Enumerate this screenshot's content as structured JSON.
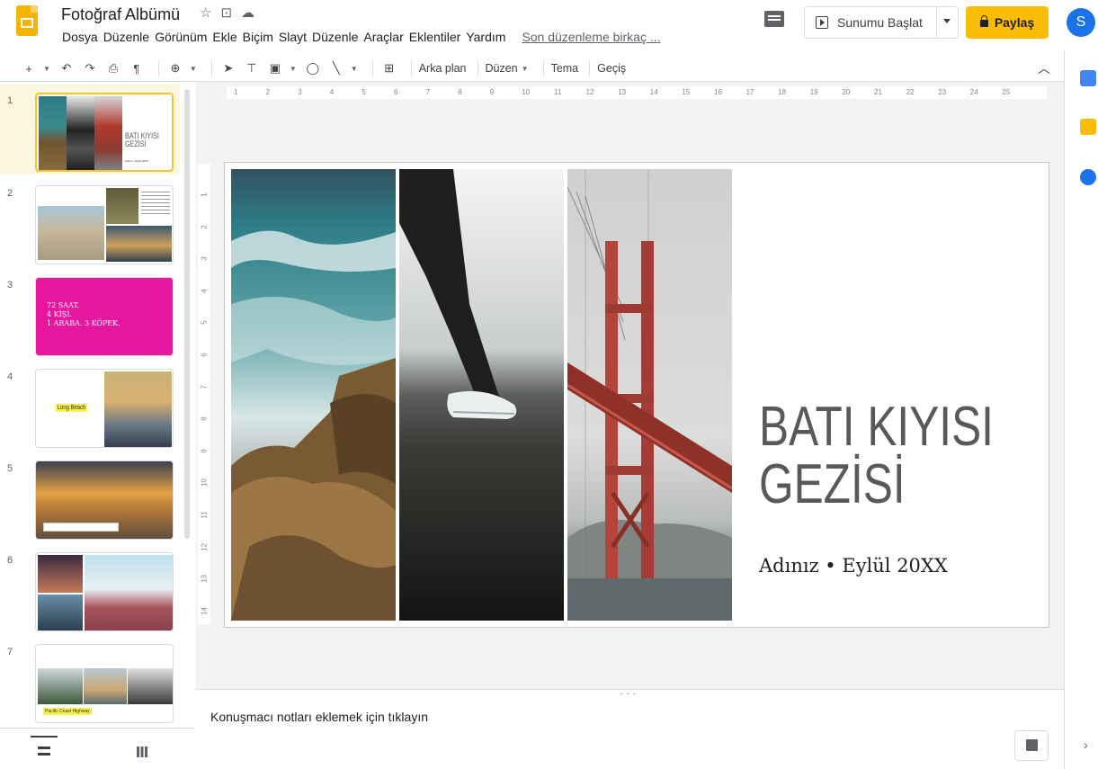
{
  "header": {
    "doc_title": "Fotoğraf Albümü",
    "star_icon": "star-icon",
    "move_icon": "folder-move-icon",
    "cloud_icon": "cloud-status-icon",
    "menus": [
      "Dosya",
      "Düzenle",
      "Görünüm",
      "Ekle",
      "Biçim",
      "Slayt",
      "Düzenle",
      "Araçlar",
      "Eklentiler",
      "Yardım"
    ],
    "last_edit": "Son düzenleme birkaç ...",
    "present_label": "Sunumu Başlat",
    "share_label": "Paylaş",
    "avatar_letter": "S",
    "share_color": "#fbbc04",
    "avatar_color": "#1a73e8"
  },
  "toolbar": {
    "background_label": "Arka plan",
    "layout_label": "Düzen",
    "theme_label": "Tema",
    "transition_label": "Geçiş"
  },
  "filmstrip": {
    "slides": [
      {
        "num": "1",
        "title": "BATI KIYISI GEZİSİ",
        "subtitle": "Adınız • Eylül 20XX"
      },
      {
        "num": "2"
      },
      {
        "num": "3",
        "lines": [
          "72 SAAT.",
          "4 KİŞİ.",
          "1 ARABA. 3 KÖPEK."
        ],
        "bg": "#e6169e"
      },
      {
        "num": "4",
        "label": "Long Beach"
      },
      {
        "num": "5"
      },
      {
        "num": "6"
      },
      {
        "num": "7",
        "label": "Pacific Coast Highway"
      }
    ],
    "selected": "1"
  },
  "ruler": {
    "h_ticks": [
      "1",
      "2",
      "3",
      "4",
      "5",
      "6",
      "7",
      "8",
      "9",
      "10",
      "11",
      "12",
      "13",
      "14",
      "15",
      "16",
      "17",
      "18",
      "19",
      "20",
      "21",
      "22",
      "23",
      "24",
      "25"
    ],
    "v_ticks": [
      "1",
      "2",
      "3",
      "4",
      "5",
      "6",
      "7",
      "8",
      "9",
      "10",
      "11",
      "12",
      "13",
      "14"
    ]
  },
  "slide": {
    "title_line1": "BATI KIYISI",
    "title_line2": "GEZİSİ",
    "subtitle": "Adınız • Eylül 20XX"
  },
  "notes": {
    "placeholder": "Konuşmacı notları eklemek için tıklayın"
  }
}
